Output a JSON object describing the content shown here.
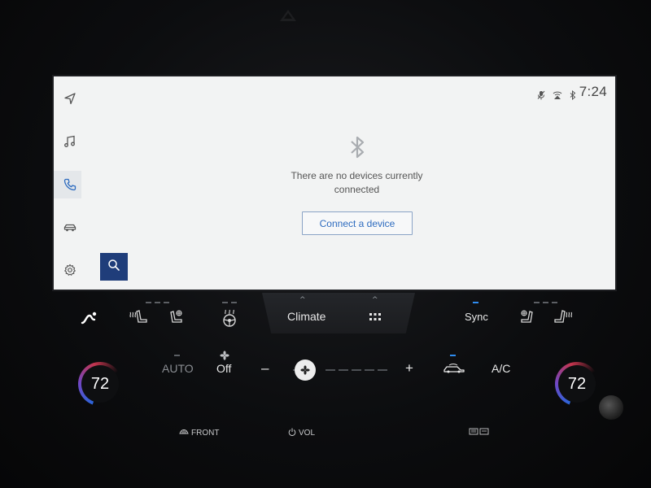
{
  "status": {
    "time": "7:24"
  },
  "sidebar": {
    "items": [
      {
        "icon": "navigation-icon"
      },
      {
        "icon": "music-icon"
      },
      {
        "icon": "phone-icon",
        "active": true
      },
      {
        "icon": "car-icon"
      },
      {
        "icon": "settings-icon"
      }
    ],
    "search_icon": "search-icon"
  },
  "main": {
    "message": "There are no devices currently connected",
    "message_line1": "There are no devices currently",
    "message_line2": "connected",
    "connect_label": "Connect a device"
  },
  "climate": {
    "tab_climate": "Climate",
    "sync_label": "Sync",
    "auto_label": "AUTO",
    "fan_label": "Off",
    "minus_label": "–",
    "plus_label": "+",
    "ac_label": "A/C",
    "left_temp": "72",
    "right_temp": "72",
    "front_label": "FRONT",
    "vol_label": "VOL",
    "accent_color": "#2f8cf0"
  }
}
